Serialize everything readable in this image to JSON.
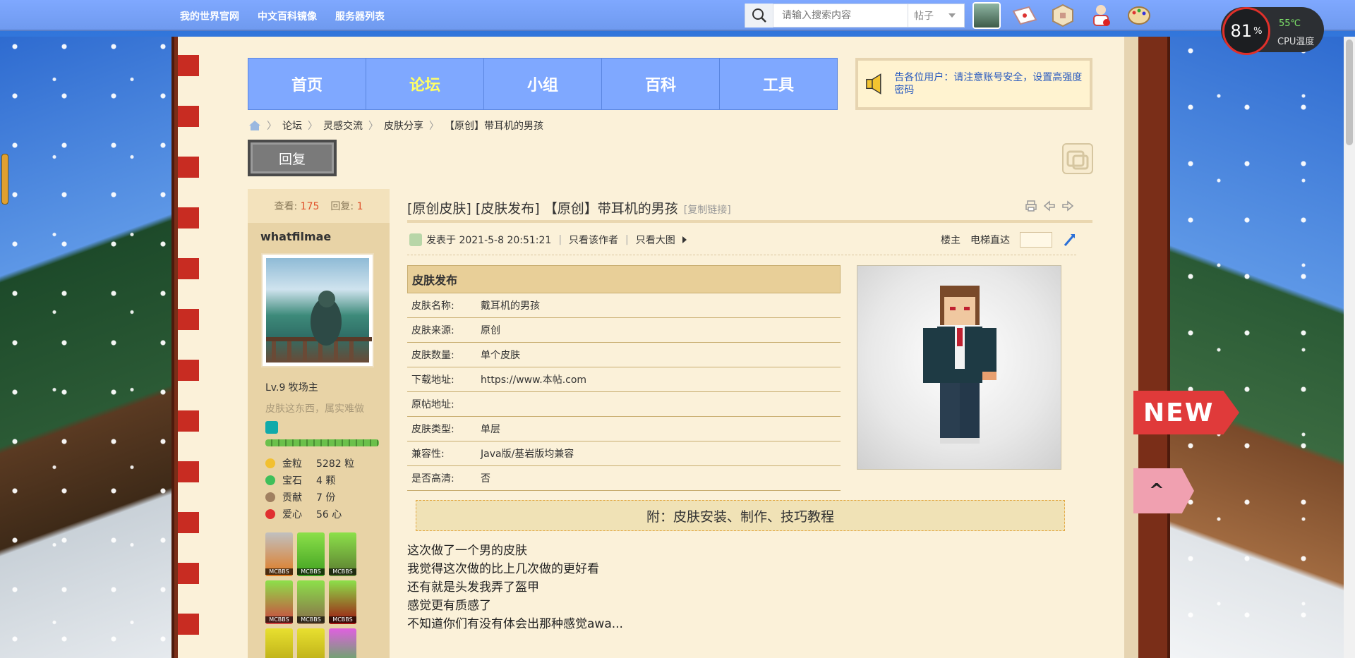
{
  "topbar": {
    "links": [
      "我的世界官网",
      "中文百科镜像",
      "服务器列表"
    ],
    "search": {
      "placeholder": "请输入搜索内容",
      "type": "帖子"
    }
  },
  "cpu": {
    "percent": "81",
    "percent_unit": "%",
    "temp": "55℃",
    "label": "CPU温度"
  },
  "nav": {
    "items": [
      "首页",
      "论坛",
      "小组",
      "百科",
      "工具"
    ],
    "active": "论坛"
  },
  "notice": {
    "text": "告各位用户：请注意账号安全，设置高强度密码"
  },
  "breadcrumb": [
    "论坛",
    "灵感交流",
    "皮肤分享",
    "【原创】带耳机的男孩"
  ],
  "actions": {
    "reply": "回复"
  },
  "user": {
    "views_label": "查看:",
    "views": "175",
    "replies_label": "回复:",
    "replies": "1",
    "name": "whatfilmae",
    "level": "Lv.9 牧场主",
    "signature": "皮肤这东西，属实难做",
    "progress": 1.0,
    "resources": [
      {
        "name": "金粒",
        "value": "5282 粒",
        "color": "#f2c030"
      },
      {
        "name": "宝石",
        "value": "4 颗",
        "color": "#3fbf5a"
      },
      {
        "name": "贡献",
        "value": "7 份",
        "color": "#a08060"
      },
      {
        "name": "爱心",
        "value": "56 心",
        "color": "#e03030"
      }
    ],
    "medal_label": "MCBBS"
  },
  "post": {
    "title": "[原创皮肤] [皮肤发布] 【原创】带耳机的男孩",
    "copy_link": "[复制链接]",
    "posted_at": "发表于 2021-5-8 20:51:21",
    "only_author": "只看该作者",
    "only_big_image": "只看大图",
    "floor_owner": "楼主",
    "elevator": "电梯直达",
    "table_title": "皮肤发布",
    "rows": [
      {
        "k": "皮肤名称:",
        "v": "戴耳机的男孩"
      },
      {
        "k": "皮肤来源:",
        "v": "原创"
      },
      {
        "k": "皮肤数量:",
        "v": "单个皮肤"
      },
      {
        "k": "下载地址:",
        "v": "https://www.本帖.com"
      },
      {
        "k": "原帖地址:",
        "v": ""
      },
      {
        "k": "皮肤类型:",
        "v": "单层"
      },
      {
        "k": "兼容性:",
        "v": "Java版/基岩版均兼容"
      },
      {
        "k": "是否高清:",
        "v": "否"
      }
    ],
    "tutorial": "附：皮肤安装、制作、技巧教程",
    "body": [
      "这次做了一个男的皮肤",
      "我觉得这次做的比上几次做的更好看",
      "还有就是头发我弄了盔甲",
      "感觉更有质感了",
      "不知道你们有没有体会出那种感觉awa..."
    ]
  },
  "side_tags": {
    "new": "NEW",
    "up": "^"
  }
}
